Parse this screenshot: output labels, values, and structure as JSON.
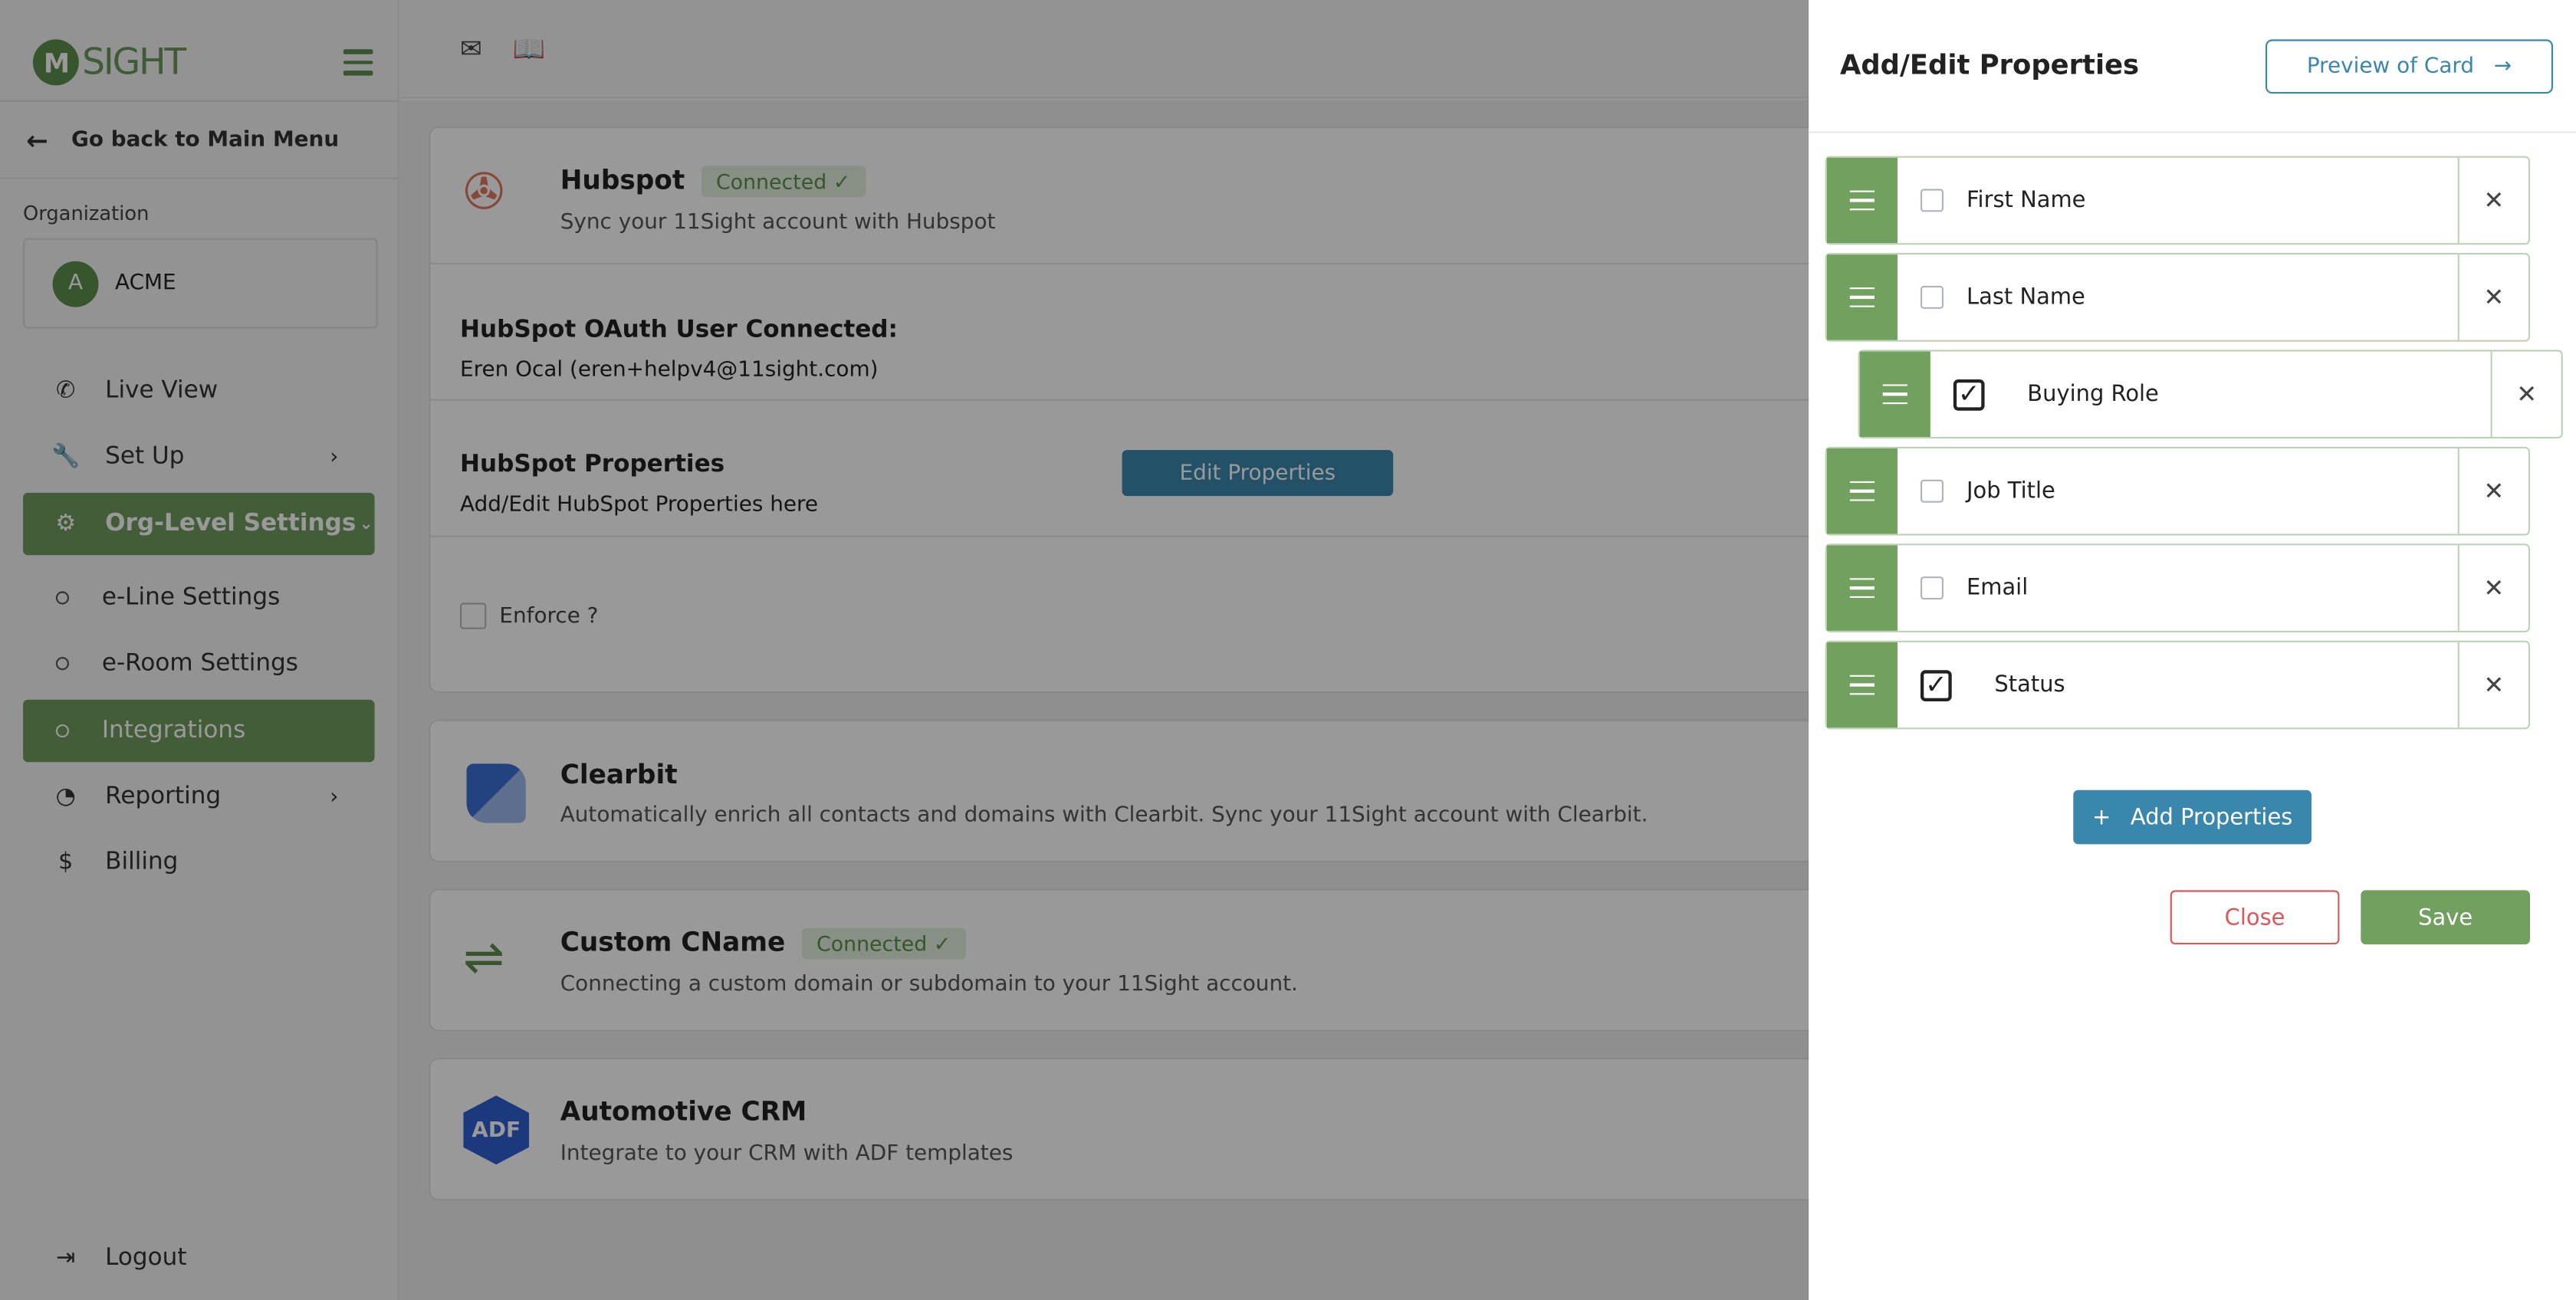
{
  "sidebar": {
    "logo_text": "SIGHT",
    "logo_mark": "M",
    "back_label": "Go back to Main Menu",
    "org_label": "Organization",
    "org_initial": "A",
    "org_name": "ACME",
    "items": [
      {
        "label": "Live View",
        "icon": "phone-icon"
      },
      {
        "label": "Set Up",
        "icon": "wrench-icon"
      },
      {
        "label": "Org-Level Settings",
        "icon": "gear-icon"
      },
      {
        "label": "e-Line Settings"
      },
      {
        "label": "e-Room Settings"
      },
      {
        "label": "Integrations"
      },
      {
        "label": "Reporting",
        "icon": "pie-chart-icon"
      },
      {
        "label": "Billing",
        "icon": "dollar-icon"
      }
    ],
    "logout": "Logout"
  },
  "main": {
    "hubspot": {
      "title": "Hubspot",
      "badge": "Connected",
      "subtitle": "Sync your 11Sight account with Hubspot",
      "oauth_label": "HubSpot OAuth User Connected:",
      "oauth_user": "Eren Ocal (eren+helpv4@11sight.com)",
      "props_title": "HubSpot Properties",
      "props_sub": "Add/Edit HubSpot Properties here",
      "edit_button": "Edit Properties",
      "enforce": "Enforce ?"
    },
    "clearbit": {
      "title": "Clearbit",
      "subtitle": "Automatically enrich all contacts and domains with Clearbit. Sync your 11Sight account with Clearbit."
    },
    "cname": {
      "title": "Custom CName",
      "badge": "Connected",
      "subtitle": "Connecting a custom domain or subdomain to your 11Sight account."
    },
    "adf": {
      "title": "Automotive CRM",
      "logo": "ADF",
      "subtitle": "Integrate to your CRM with ADF templates"
    }
  },
  "panel": {
    "title": "Add/Edit Properties",
    "preview_button": "Preview of Card",
    "properties": [
      {
        "label": "First Name",
        "checked": false
      },
      {
        "label": "Last Name",
        "checked": false
      },
      {
        "label": "Buying Role",
        "checked": true
      },
      {
        "label": "Job Title",
        "checked": false
      },
      {
        "label": "Email",
        "checked": false
      },
      {
        "label": "Status",
        "checked": true
      }
    ],
    "add_button": "Add Properties",
    "close_button": "Close",
    "save_button": "Save"
  },
  "colors": {
    "brand_green": "#72a05e",
    "accent_blue": "#3a87ae",
    "danger": "#e05656"
  }
}
